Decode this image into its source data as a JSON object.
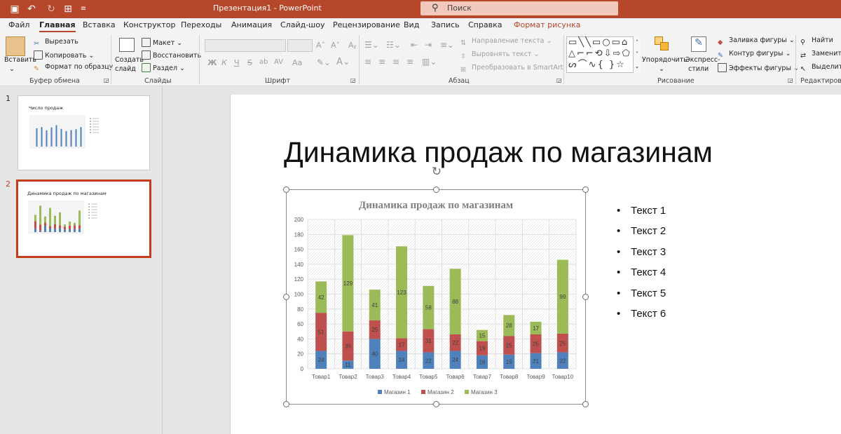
{
  "titlebar": {
    "title": "Презентация1 - PowerPoint",
    "search_label": "Поиск",
    "color": "#b7472a"
  },
  "menu": {
    "tabs": [
      "Файл",
      "Главная",
      "Вставка",
      "Конструктор",
      "Переходы",
      "Анимация",
      "Слайд-шоу",
      "Рецензирование",
      "Вид",
      "Запись",
      "Справка",
      "Формат рисунка"
    ],
    "active": "Главная",
    "accent_tab": "Формат рисунка"
  },
  "ribbon": {
    "clipboard": {
      "paste": "Вставить",
      "cut": "Вырезать",
      "copy": "Копировать",
      "format_painter": "Формат по образцу",
      "label": "Буфер обмена"
    },
    "slides": {
      "new_slide_1": "Создать",
      "new_slide_2": "слайд",
      "layout": "Макет",
      "reset": "Восстановить",
      "section": "Раздел",
      "label": "Слайды"
    },
    "font": {
      "label": "Шрифт",
      "buttons": [
        "Ж",
        "К",
        "Ч",
        "S",
        "ab",
        "AV",
        "Aa"
      ]
    },
    "paragraph": {
      "text_direction": "Направление текста",
      "align_text": "Выровнять текст",
      "smartart": "Преобразовать в SmartArt",
      "label": "Абзац"
    },
    "drawing": {
      "arrange": "Упорядочить",
      "quick_styles_1": "Экспресс-",
      "quick_styles_2": "стили",
      "fill": "Заливка фигуры",
      "outline": "Контур фигуры",
      "effects": "Эффекты фигуры",
      "label": "Рисование"
    },
    "editing": {
      "find": "Найти",
      "replace": "Заменить",
      "select": "Выделить",
      "label": "Редактирование"
    }
  },
  "thumbnails": [
    {
      "num": "1",
      "title": "Число продаж"
    },
    {
      "num": "2",
      "title": "Динамика продаж по магазинам"
    }
  ],
  "slide": {
    "title": "Динамика продаж по магазинам",
    "bullets": [
      "Текст 1",
      "Текст 2",
      "Текст 3",
      "Текст 4",
      "Текст 5",
      "Текст 6"
    ]
  },
  "chart_data": {
    "type": "bar",
    "stacked": true,
    "title": "Динамика продаж по магазинам",
    "categories": [
      "Товар1",
      "Товар2",
      "Товар3",
      "Товар4",
      "Товар5",
      "Товар6",
      "Товар7",
      "Товар8",
      "Товар9",
      "Товар10"
    ],
    "series": [
      {
        "name": "Магазин 1",
        "color": "#4f81bd",
        "values": [
          24,
          11,
          40,
          24,
          22,
          24,
          18,
          19,
          21,
          22
        ]
      },
      {
        "name": "Магазин 2",
        "color": "#c0504d",
        "values": [
          51,
          39,
          25,
          17,
          31,
          22,
          19,
          25,
          25,
          25
        ]
      },
      {
        "name": "Магазин 3",
        "color": "#9bbb59",
        "values": [
          42,
          129,
          41,
          123,
          58,
          88,
          15,
          28,
          17,
          99
        ]
      }
    ],
    "ylim": [
      0,
      200
    ],
    "yticks": [
      "0",
      "20",
      "40",
      "60",
      "80",
      "100",
      "120",
      "140",
      "160",
      "180",
      "200"
    ],
    "grid": true,
    "legend": "bottom"
  },
  "thumb_chart": {
    "bars": [
      124,
      132,
      110,
      130,
      145,
      120,
      105,
      112,
      118,
      132
    ]
  }
}
